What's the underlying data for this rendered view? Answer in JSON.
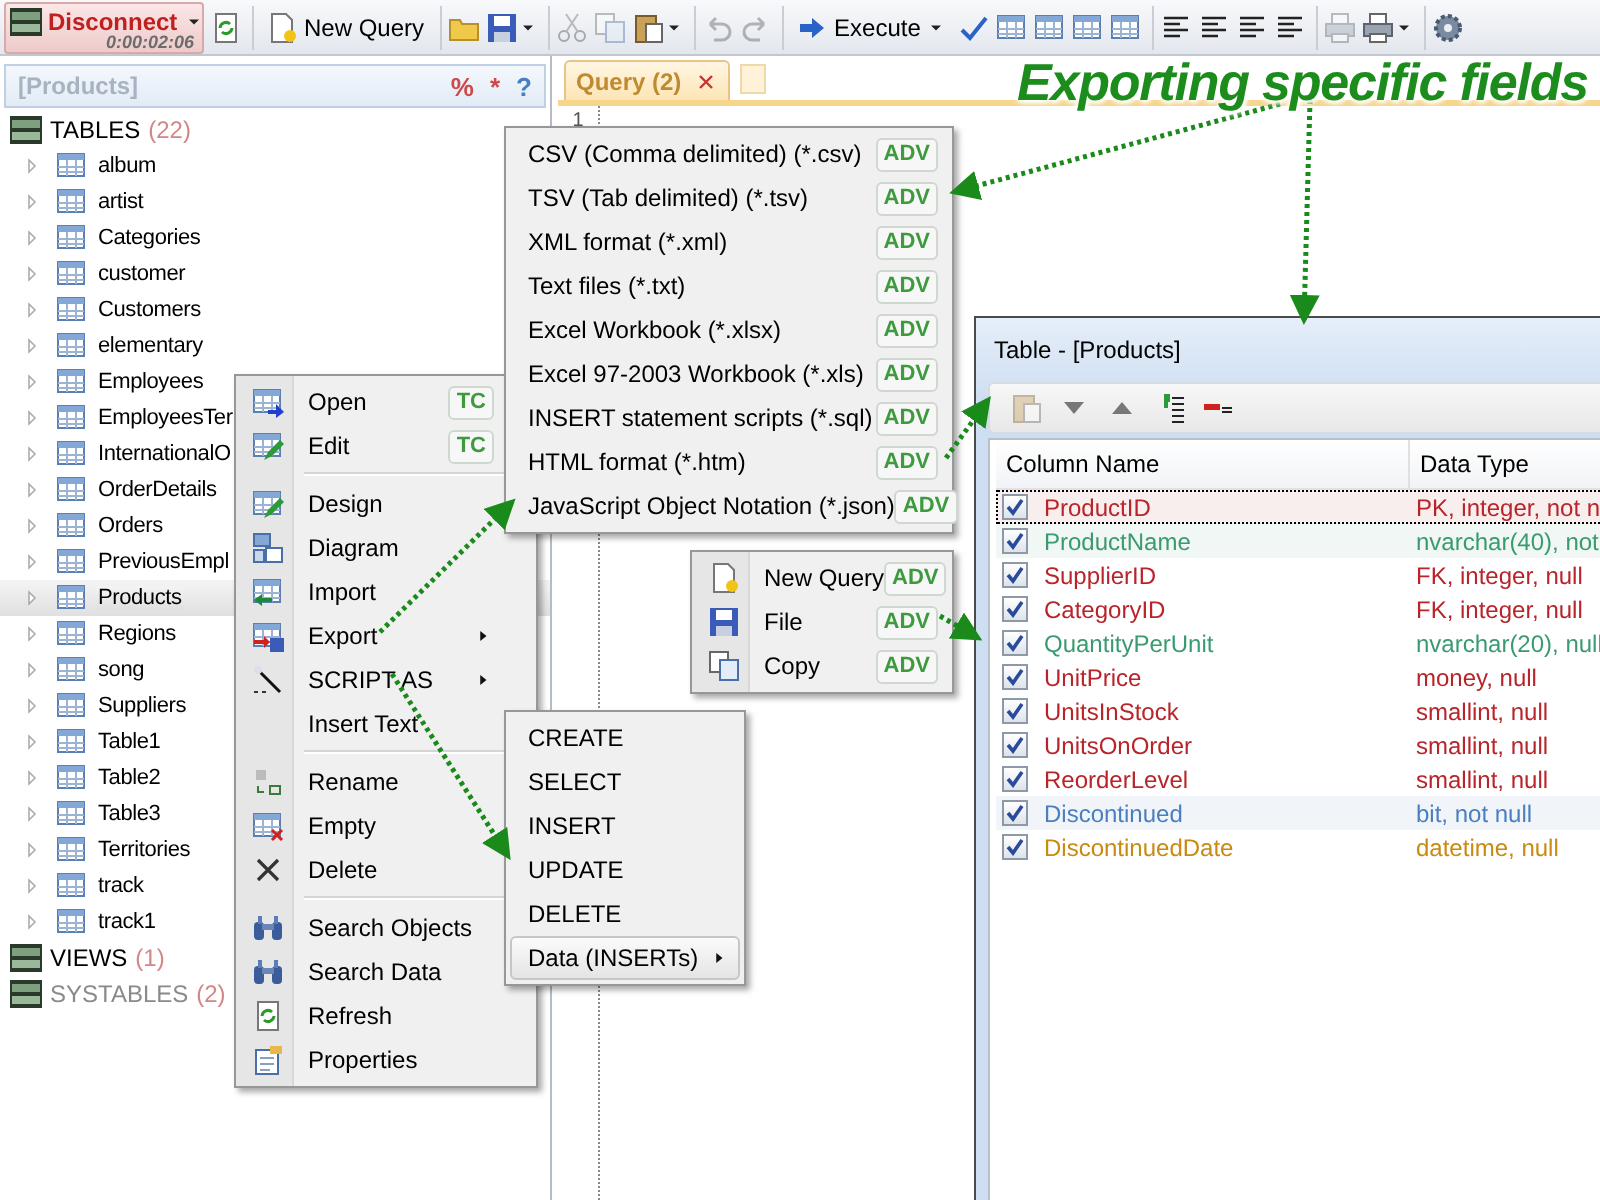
{
  "headline": "Exporting specific fields",
  "toolbar": {
    "groups": [
      [
        {
          "kind": "disconnect",
          "label": "Disconnect",
          "timer": "0:00:02:06"
        },
        {
          "kind": "icon",
          "disabled": false,
          "dropdown": false
        }
      ],
      [
        {
          "kind": "button",
          "label": "New Query",
          "dropdown": false
        }
      ],
      [
        {
          "kind": "icon",
          "disabled": false,
          "dropdown": false
        },
        {
          "kind": "icon",
          "disabled": false,
          "dropdown": true
        }
      ],
      [
        {
          "kind": "icon",
          "disabled": true,
          "dropdown": false
        },
        {
          "kind": "icon",
          "disabled": true,
          "dropdown": false
        },
        {
          "kind": "icon",
          "disabled": false,
          "dropdown": true
        }
      ],
      [
        {
          "kind": "icon",
          "disabled": true,
          "dropdown": false
        },
        {
          "kind": "icon",
          "disabled": true,
          "dropdown": false
        }
      ],
      [
        {
          "kind": "button",
          "label": "Execute",
          "dropdown": true
        },
        {
          "kind": "icon",
          "disabled": false,
          "dropdown": false
        },
        {
          "kind": "icon",
          "disabled": false,
          "dropdown": false
        },
        {
          "kind": "icon",
          "disabled": false,
          "dropdown": false
        },
        {
          "kind": "icon",
          "disabled": false,
          "dropdown": false
        },
        {
          "kind": "icon",
          "disabled": false,
          "dropdown": false
        }
      ],
      [
        {
          "kind": "icon",
          "disabled": false,
          "dropdown": false
        },
        {
          "kind": "icon",
          "disabled": false,
          "dropdown": false
        },
        {
          "kind": "icon",
          "disabled": false,
          "dropdown": false
        },
        {
          "kind": "icon",
          "disabled": false,
          "dropdown": false
        }
      ],
      [
        {
          "kind": "icon",
          "disabled": true,
          "dropdown": false
        },
        {
          "kind": "icon",
          "disabled": false,
          "dropdown": true
        }
      ],
      [
        {
          "kind": "icon",
          "disabled": false,
          "dropdown": false
        }
      ]
    ]
  },
  "explorer": {
    "title": "[Products]",
    "tools": [
      {
        "label": "%",
        "color": "#d04848"
      },
      {
        "label": "*",
        "color": "#d04848"
      },
      {
        "label": "?",
        "color": "#4a7fbf"
      }
    ],
    "sections": [
      {
        "label": "TABLES",
        "count": "(22)",
        "disabled": false,
        "items": [
          {
            "name": "album",
            "selected": false
          },
          {
            "name": "artist",
            "selected": false
          },
          {
            "name": "Categories",
            "selected": false
          },
          {
            "name": "customer",
            "selected": false
          },
          {
            "name": "Customers",
            "selected": false
          },
          {
            "name": "elementary",
            "selected": false
          },
          {
            "name": "Employees",
            "selected": false
          },
          {
            "name": "EmployeesTer",
            "selected": false
          },
          {
            "name": "InternationalO",
            "selected": false
          },
          {
            "name": "OrderDetails",
            "selected": false
          },
          {
            "name": "Orders",
            "selected": false
          },
          {
            "name": "PreviousEmpl",
            "selected": false
          },
          {
            "name": "Products",
            "selected": true
          },
          {
            "name": "Regions",
            "selected": false
          },
          {
            "name": "song",
            "selected": false
          },
          {
            "name": "Suppliers",
            "selected": false
          },
          {
            "name": "Table1",
            "selected": false
          },
          {
            "name": "Table2",
            "selected": false
          },
          {
            "name": "Table3",
            "selected": false
          },
          {
            "name": "Territories",
            "selected": false
          },
          {
            "name": "track",
            "selected": false
          },
          {
            "name": "track1",
            "selected": false
          }
        ]
      },
      {
        "label": "VIEWS",
        "count": "(1)",
        "disabled": false
      },
      {
        "label": "SYSTABLES",
        "count": "(2)",
        "disabled": true
      }
    ]
  },
  "editor": {
    "tabs": [
      {
        "label": "Query (2)",
        "selected": true
      }
    ],
    "line_numbers": [
      "1"
    ]
  },
  "context_menu": {
    "groups": [
      [
        {
          "label": "Open",
          "badge": "TC",
          "submenu": false
        },
        {
          "label": "Edit",
          "badge": "TC",
          "submenu": false
        }
      ],
      [
        {
          "label": "Design",
          "submenu": false
        },
        {
          "label": "Diagram",
          "submenu": false
        },
        {
          "label": "Import",
          "submenu": false
        },
        {
          "label": "Export",
          "submenu": true
        },
        {
          "label": "SCRIPT AS",
          "submenu": true
        },
        {
          "label": "Insert Text",
          "submenu": false
        }
      ],
      [
        {
          "label": "Rename",
          "submenu": false
        },
        {
          "label": "Empty",
          "submenu": false
        },
        {
          "label": "Delete",
          "submenu": false
        }
      ],
      [
        {
          "label": "Search Objects",
          "submenu": false
        },
        {
          "label": "Search Data",
          "submenu": false
        },
        {
          "label": "Refresh",
          "submenu": false
        },
        {
          "label": "Properties",
          "submenu": false
        }
      ]
    ]
  },
  "export_menu": {
    "items": [
      {
        "label": "CSV (Comma delimited) (*.csv)",
        "badge": "ADV"
      },
      {
        "label": "TSV (Tab delimited) (*.tsv)",
        "badge": "ADV"
      },
      {
        "label": "XML format (*.xml)",
        "badge": "ADV"
      },
      {
        "label": "Text files (*.txt)",
        "badge": "ADV"
      },
      {
        "label": "Excel Workbook (*.xlsx)",
        "badge": "ADV"
      },
      {
        "label": "Excel 97-2003 Workbook (*.xls)",
        "badge": "ADV"
      },
      {
        "label": "INSERT statement scripts (*.sql)",
        "badge": "ADV"
      },
      {
        "label": "HTML format (*.htm)",
        "badge": "ADV"
      },
      {
        "label": "JavaScript Object Notation (*.json)",
        "badge": "ADV"
      }
    ]
  },
  "target_menu": {
    "items": [
      {
        "label": "New Query",
        "badge": "ADV"
      },
      {
        "label": "File",
        "badge": "ADV"
      },
      {
        "label": "Copy",
        "badge": "ADV"
      }
    ]
  },
  "script_menu": {
    "items": [
      {
        "label": "CREATE",
        "selected": false,
        "submenu": false
      },
      {
        "label": "SELECT",
        "selected": false,
        "submenu": false
      },
      {
        "label": "INSERT",
        "selected": false,
        "submenu": false
      },
      {
        "label": "UPDATE",
        "selected": false,
        "submenu": false
      },
      {
        "label": "DELETE",
        "selected": false,
        "submenu": false
      },
      {
        "label": "Data (INSERTs)",
        "selected": true,
        "submenu": true
      }
    ]
  },
  "table_window": {
    "title": "Table - [Products]",
    "columns": [
      "Column Name",
      "Data Type"
    ],
    "rows": [
      {
        "name": "ProductID",
        "type": "PK, integer, not n",
        "checked": true,
        "color": "#b8242a",
        "highlighted": true,
        "selected": true
      },
      {
        "name": "ProductName",
        "type": "nvarchar(40), not",
        "checked": true,
        "color": "#3a9a70",
        "highlighted": true,
        "selected": false
      },
      {
        "name": "SupplierID",
        "type": "FK, integer, null",
        "checked": true,
        "color": "#b8242a",
        "highlighted": false,
        "selected": false
      },
      {
        "name": "CategoryID",
        "type": "FK, integer, null",
        "checked": true,
        "color": "#b8242a",
        "highlighted": false,
        "selected": false
      },
      {
        "name": "QuantityPerUnit",
        "type": "nvarchar(20), null",
        "checked": true,
        "color": "#3a9a70",
        "highlighted": false,
        "selected": false
      },
      {
        "name": "UnitPrice",
        "type": "money, null",
        "checked": true,
        "color": "#b8242a",
        "highlighted": false,
        "selected": false
      },
      {
        "name": "UnitsInStock",
        "type": "smallint, null",
        "checked": true,
        "color": "#b8242a",
        "highlighted": false,
        "selected": false
      },
      {
        "name": "UnitsOnOrder",
        "type": "smallint, null",
        "checked": true,
        "color": "#b8242a",
        "highlighted": false,
        "selected": false
      },
      {
        "name": "ReorderLevel",
        "type": "smallint, null",
        "checked": true,
        "color": "#b8242a",
        "highlighted": false,
        "selected": false
      },
      {
        "name": "Discontinued",
        "type": "bit, not null",
        "checked": true,
        "color": "#4a7fbf",
        "highlighted": true,
        "selected": false
      },
      {
        "name": "DiscontinuedDate",
        "type": "datetime, null",
        "checked": true,
        "color": "#c98a10",
        "highlighted": false,
        "selected": false
      }
    ]
  }
}
